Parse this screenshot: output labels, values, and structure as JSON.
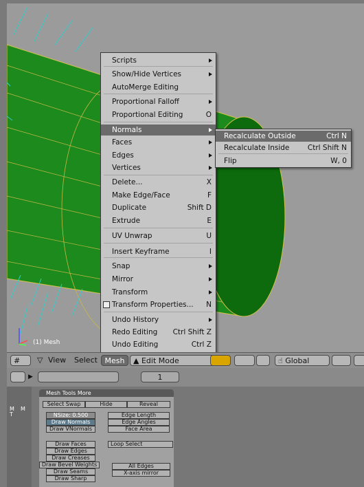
{
  "viewport": {
    "object_label": "(1) Mesh"
  },
  "menu": {
    "items": [
      {
        "label": "Scripts",
        "shortcut": "",
        "submenu": true
      },
      {
        "label": "Show/Hide Vertices",
        "shortcut": "",
        "submenu": true
      },
      {
        "label": "AutoMerge Editing",
        "shortcut": "",
        "submenu": false
      },
      {
        "label": "Proportional Falloff",
        "shortcut": "",
        "submenu": true
      },
      {
        "label": "Proportional Editing",
        "shortcut": "O",
        "submenu": false
      },
      {
        "label": "Normals",
        "shortcut": "",
        "submenu": true,
        "highlighted": true
      },
      {
        "label": "Faces",
        "shortcut": "",
        "submenu": true
      },
      {
        "label": "Edges",
        "shortcut": "",
        "submenu": true
      },
      {
        "label": "Vertices",
        "shortcut": "",
        "submenu": true
      },
      {
        "label": "Delete...",
        "shortcut": "X",
        "submenu": false
      },
      {
        "label": "Make Edge/Face",
        "shortcut": "F",
        "submenu": false
      },
      {
        "label": "Duplicate",
        "shortcut": "Shift D",
        "submenu": false
      },
      {
        "label": "Extrude",
        "shortcut": "E",
        "submenu": false
      },
      {
        "label": "UV Unwrap",
        "shortcut": "U",
        "submenu": false
      },
      {
        "label": "Insert Keyframe",
        "shortcut": "I",
        "submenu": false
      },
      {
        "label": "Snap",
        "shortcut": "",
        "submenu": true
      },
      {
        "label": "Mirror",
        "shortcut": "",
        "submenu": true
      },
      {
        "label": "Transform",
        "shortcut": "",
        "submenu": true
      },
      {
        "label": "Transform Properties...",
        "shortcut": "N",
        "submenu": false,
        "checkbox": true
      },
      {
        "label": "Undo History",
        "shortcut": "",
        "submenu": true
      },
      {
        "label": "Redo Editing",
        "shortcut": "Ctrl Shift Z",
        "submenu": false
      },
      {
        "label": "Undo Editing",
        "shortcut": "Ctrl Z",
        "submenu": false
      }
    ]
  },
  "submenu": {
    "items": [
      {
        "label": "Recalculate Outside",
        "shortcut": "Ctrl N",
        "highlighted": true
      },
      {
        "label": "Recalculate Inside",
        "shortcut": "Ctrl Shift N"
      },
      {
        "label": "Flip",
        "shortcut": "W, 0"
      }
    ]
  },
  "header": {
    "view": "View",
    "select": "Select",
    "mesh": "Mesh",
    "mode": "Edit Mode",
    "orientation": "Global"
  },
  "buttons_header": {
    "frame": "1"
  },
  "panel": {
    "tabs_label": "Mesh Tools More",
    "tab_left_letters": [
      "M",
      "T"
    ],
    "tab_mid_letter": "M",
    "select_swap": "Select Swap",
    "hide": "Hide",
    "reveal": "Reveal",
    "nsize": "NSize: 0.500",
    "edge_length": "Edge Length",
    "draw_normals": "Draw Normals",
    "edge_angles": "Edge Angles",
    "draw_vnormals": "Draw VNormals",
    "face_area": "Face Area",
    "draw_faces": "Draw Faces",
    "loop_select": "Loop Select",
    "draw_edges": "Draw Edges",
    "draw_creases": "Draw Creases",
    "draw_bevel_weights": "Draw Bevel Weights",
    "all_edges": "All Edges",
    "draw_seams": "Draw Seams",
    "xaxis_mirror": "X-axis mirror",
    "draw_sharp": "Draw Sharp"
  },
  "colors": {
    "mesh_face": "#1a8c1a",
    "normals": "#33cccc",
    "menu_bg": "#c6c6c6",
    "menu_highlight": "#6b6b6b"
  }
}
